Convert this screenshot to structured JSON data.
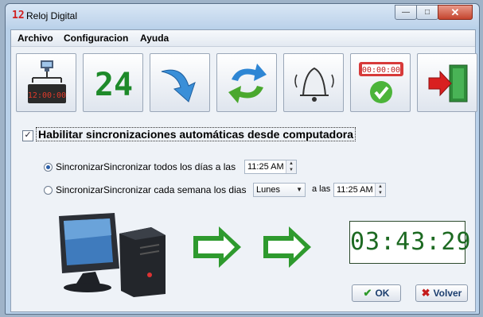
{
  "window": {
    "title": "Reloj Digital",
    "icon_text": "12"
  },
  "menu": [
    {
      "label": "Archivo"
    },
    {
      "label": "Configuracion"
    },
    {
      "label": "Ayuda"
    }
  ],
  "toolbar": [
    {
      "icon": "network-clock-icon",
      "clock_text": "12:00:00"
    },
    {
      "icon": "24-hour-icon",
      "text": "24"
    },
    {
      "icon": "arrow-down-icon"
    },
    {
      "icon": "sync-arrows-icon"
    },
    {
      "icon": "bell-icon"
    },
    {
      "icon": "timer-check-icon",
      "clock_text": "00:00:00"
    },
    {
      "icon": "exit-door-icon"
    }
  ],
  "sync": {
    "label": "Habilitar sincronizaciones automáticas desde computadora",
    "checked": true
  },
  "options": {
    "daily": {
      "label": "SincronizarSincronizar todos los días a las",
      "time": "11:25 AM",
      "selected": true
    },
    "weekly": {
      "label": "SincronizarSincronizar cada semana los dias",
      "day": "Lunes",
      "at_label": "a las",
      "time": "11:25 AM",
      "selected": false
    }
  },
  "clock": {
    "time": "03:43:29",
    "color": "#1d6a22"
  },
  "buttons": {
    "ok": "OK",
    "back": "Volver"
  }
}
